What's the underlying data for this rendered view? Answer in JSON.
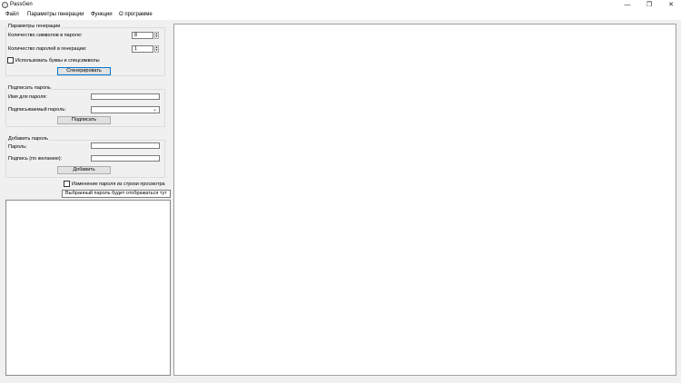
{
  "window": {
    "title": "PassGen",
    "minimize_glyph": "—",
    "restore_glyph": "❐",
    "close_glyph": "✕"
  },
  "menu": {
    "file": "Файл",
    "gen_params": "Параметры генерации",
    "functions": "Функции",
    "about": "О программе"
  },
  "gen_group": {
    "title": "Параметры генерации",
    "symbols_label": "Количество символов в пароле:",
    "symbols_value": "8",
    "count_label": "Количество паролей в генерации:",
    "count_value": "1",
    "use_special_label": "Использовать буквы и спецсимволы",
    "generate_button": "Сгенерировать"
  },
  "sign_group": {
    "title": "Подписать пароль",
    "name_label": "Имя для пароля:",
    "name_value": "",
    "target_label": "Подписываемый пароль:",
    "target_value": "",
    "sign_button": "Подписать"
  },
  "add_group": {
    "title": "Добавить пароль",
    "password_label": "Пароль:",
    "password_value": "",
    "signature_label": "Подпись (по желанию):",
    "signature_value": "",
    "add_button": "Добавить"
  },
  "view": {
    "change_label": "Изменение пароля из строки просмотра",
    "selected_text": "Выбранный пароль будет отображаться тут"
  },
  "icons": {
    "spin_up": "▲",
    "spin_down": "▼",
    "combo_arrow": "⌄"
  }
}
